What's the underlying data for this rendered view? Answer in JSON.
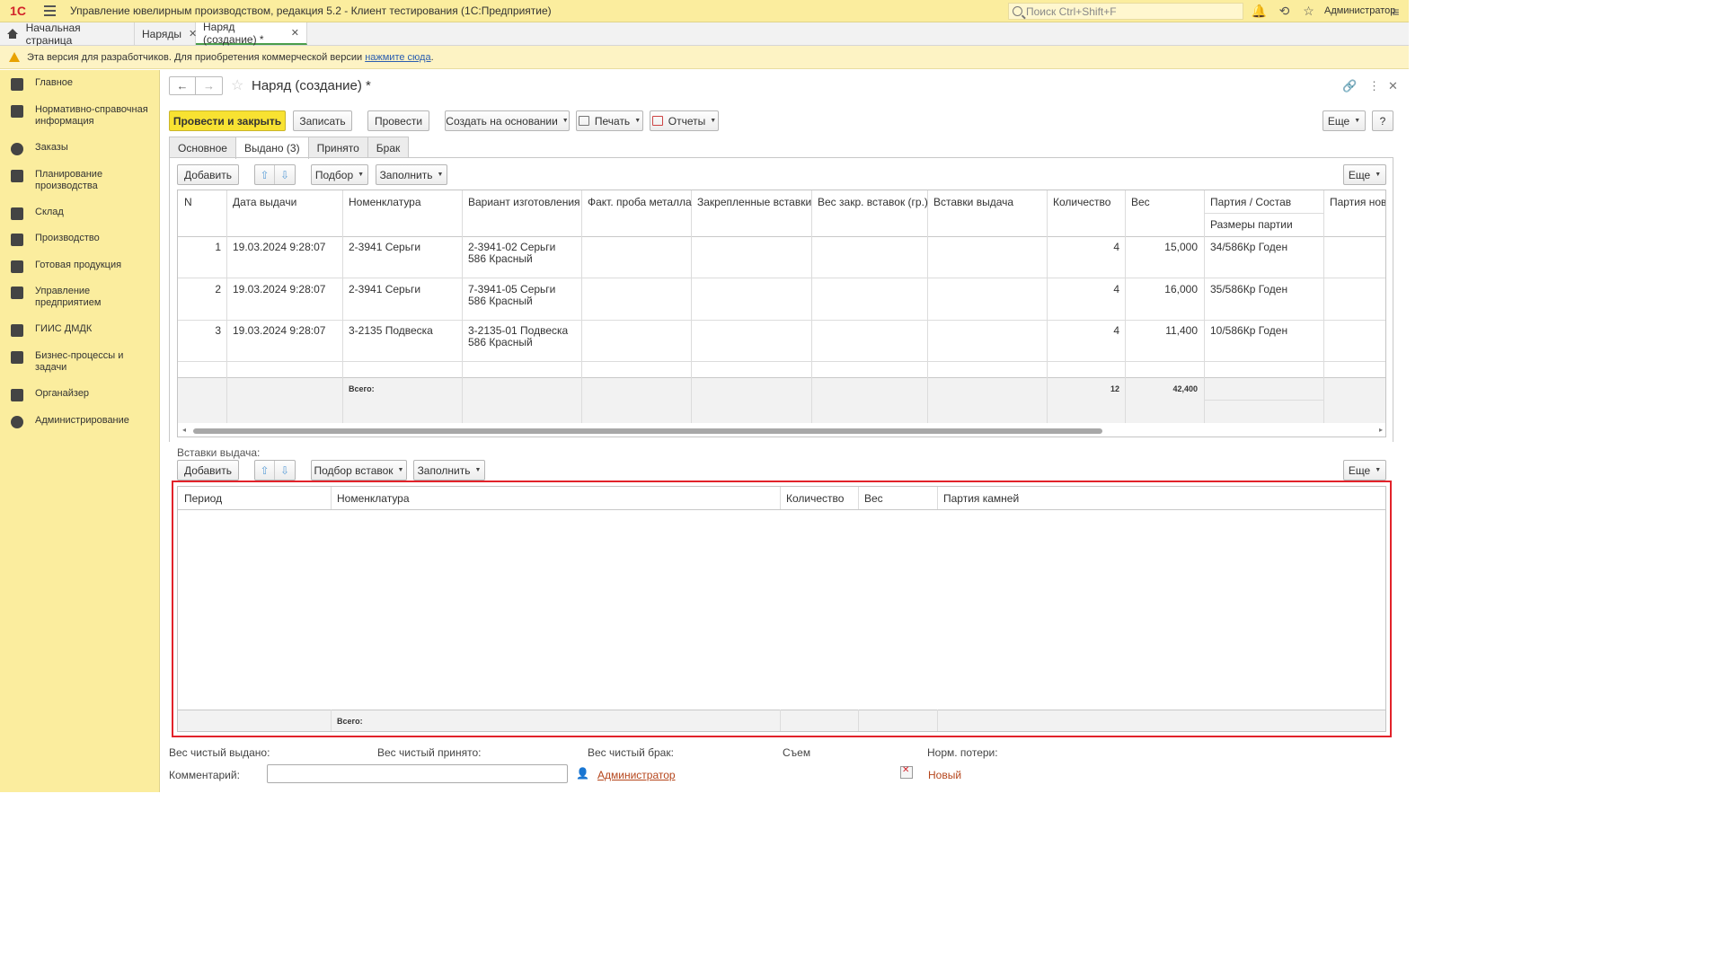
{
  "app": {
    "title": "Управление ювелирным производством, редакция 5.2  - Клиент тестирования (1С:Предприятие)",
    "logo": "1С",
    "search_placeholder": "Поиск Ctrl+Shift+F",
    "user": "Администратор"
  },
  "window_tabs": [
    {
      "label": "Начальная страница"
    },
    {
      "label": "Наряды"
    },
    {
      "label": "Наряд (создание) *"
    }
  ],
  "banner": {
    "text": "Эта версия для разработчиков. Для приобретения коммерческой версии",
    "link": "нажмите сюда",
    "tail": "."
  },
  "sidebar": {
    "items": [
      {
        "label": "Главное",
        "icon": "crown-icon"
      },
      {
        "label": "Нормативно-справочная информация",
        "icon": "reference-book-icon"
      },
      {
        "label": "Заказы",
        "icon": "pie-chart-icon"
      },
      {
        "label": "Планирование производства",
        "icon": "planning-icon"
      },
      {
        "label": "Склад",
        "icon": "warehouse-icon"
      },
      {
        "label": "Производство",
        "icon": "factory-icon"
      },
      {
        "label": "Готовая продукция",
        "icon": "bag-icon"
      },
      {
        "label": "Управление предприятием",
        "icon": "management-icon"
      },
      {
        "label": "ГИИС ДМДК",
        "icon": "giis-icon"
      },
      {
        "label": "Бизнес-процессы и задачи",
        "icon": "tasks-icon"
      },
      {
        "label": "Органайзер",
        "icon": "organizer-icon"
      },
      {
        "label": "Администрирование",
        "icon": "gear-icon"
      }
    ]
  },
  "form": {
    "title": "Наряд (создание) *",
    "toolbar": {
      "post_close": "Провести и закрыть",
      "save": "Записать",
      "post": "Провести",
      "create_based": "Создать на основании",
      "print": "Печать",
      "reports": "Отчеты",
      "more": "Еще",
      "help": "?"
    },
    "tabs": [
      "Основное",
      "Выдано (3)",
      "Принято",
      "Брак"
    ],
    "issued_toolbar": {
      "add": "Добавить",
      "pick": "Подбор",
      "fill": "Заполнить",
      "more": "Еще"
    },
    "issued_table": {
      "headers": [
        "N",
        "Дата выдачи",
        "Номенклатура",
        "Вариант изготовления",
        "Факт. проба металла",
        "Закрепленные вставки",
        "Вес закр. вставок (гр.)",
        "Вставки выдача",
        "Количество",
        "Вес",
        "Партия / Состав",
        "Партия нова"
      ],
      "subheader": "Размеры партии",
      "rows": [
        {
          "n": "1",
          "date": "19.03.2024 9:28:07",
          "nomenclature": "2-3941 Серьги",
          "variant": "2-3941-02 Серьги 586 Красный",
          "qty": "4",
          "weight": "15,000",
          "batch": "34/586Кр Годен"
        },
        {
          "n": "2",
          "date": "19.03.2024 9:28:07",
          "nomenclature": "2-3941 Серьги",
          "variant": "7-3941-05 Серьги 586 Красный",
          "qty": "4",
          "weight": "16,000",
          "batch": "35/586Кр Годен"
        },
        {
          "n": "3",
          "date": "19.03.2024 9:28:07",
          "nomenclature": "3-2135 Подвеска",
          "variant": "3-2135-01 Подвеска 586 Красный",
          "qty": "4",
          "weight": "11,400",
          "batch": "10/586Кр Годен"
        }
      ],
      "total_label": "Всего:",
      "total_qty": "12",
      "total_weight": "42,400"
    },
    "inserts": {
      "label": "Вставки выдача:",
      "toolbar": {
        "add": "Добавить",
        "pick": "Подбор вставок",
        "fill": "Заполнить",
        "more": "Еще"
      },
      "headers": [
        "Период",
        "Номенклатура",
        "Количество",
        "Вес",
        "Партия камней"
      ],
      "total_label": "Всего:"
    },
    "footer": {
      "net_issued": "Вес чистый выдано:",
      "net_received": "Вес чистый принято:",
      "net_defect": "Вес чистый брак:",
      "removal": "Съем",
      "norm_loss": "Норм. потери:",
      "comment_label": "Комментарий:",
      "author": "Администратор",
      "status": "Новый"
    }
  }
}
